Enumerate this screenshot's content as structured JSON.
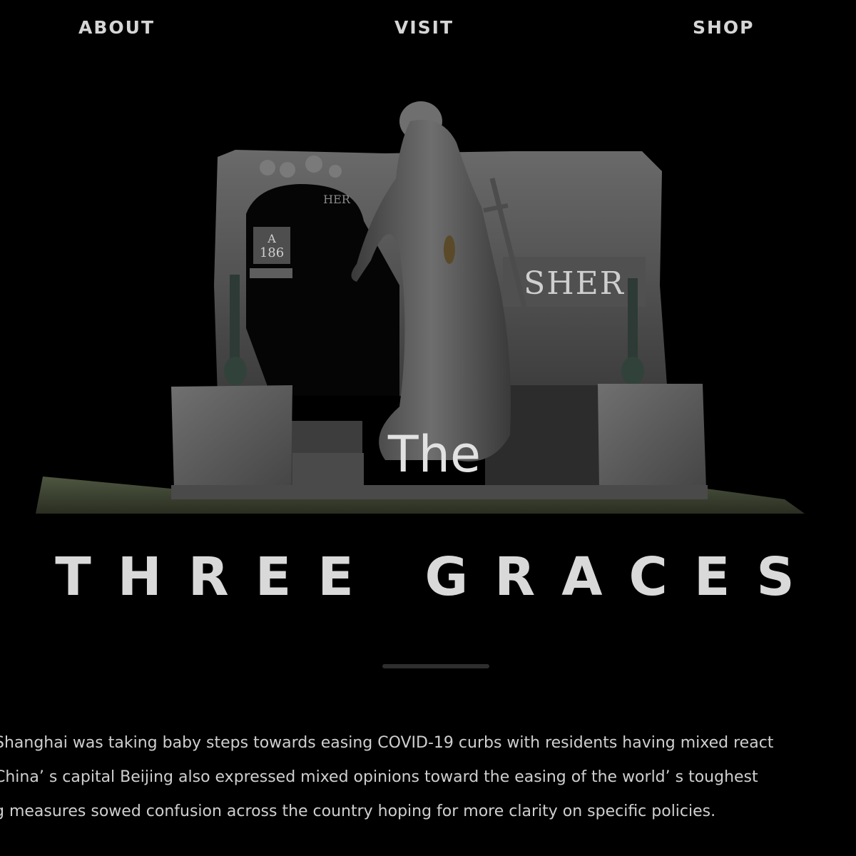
{
  "nav": {
    "items": [
      {
        "label": "ABOUT"
      },
      {
        "label": "VISIT"
      },
      {
        "label": "SHOP"
      }
    ]
  },
  "hero": {
    "image_alt": "Stone cemetery monument with a draped female statue holding a cross",
    "plaque_left_top": "HER",
    "plaque_left_line1": "A",
    "plaque_left_line2": "186",
    "plaque_right": "SHER",
    "title_small": "The",
    "title_main": "THREE GRACES"
  },
  "article": {
    "lines": [
      "Shanghai was taking baby steps towards easing COVID-19 curbs with residents having mixed react",
      "China’ s capital Beijing also expressed mixed opinions toward the easing of the world’ s toughest",
      "g measures sowed confusion across the country hoping for more clarity on specific policies."
    ]
  },
  "colors": {
    "background": "#000000",
    "text": "#d9d9d9",
    "stone": "#5a5a5a"
  }
}
